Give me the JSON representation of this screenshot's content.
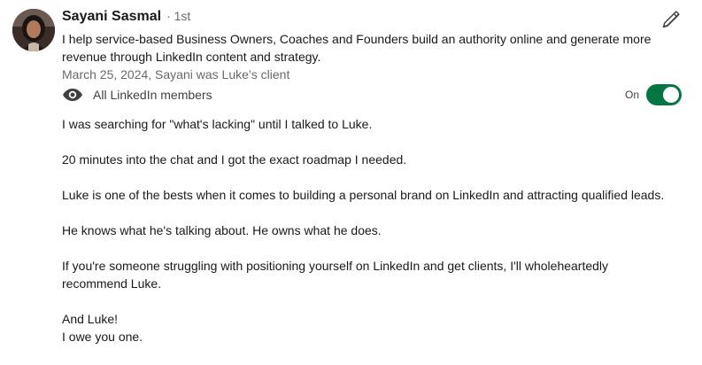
{
  "recommendation": {
    "author_name": "Sayani Sasmal",
    "degree": "· 1st",
    "headline": "I help service-based Business Owners, Coaches and Founders build an authority online and generate more revenue through LinkedIn content and strategy.",
    "meta": "March 25, 2024, Sayani was Luke’s client",
    "visibility": {
      "icon": "eye-icon",
      "label": "All LinkedIn members",
      "toggle_label": "On",
      "toggle_on": true
    },
    "edit_icon": "pencil-icon",
    "paragraphs": [
      "I was searching for \"what's lacking\" until I talked to Luke.",
      "20 minutes into the chat and I got the exact roadmap I needed.",
      "Luke is one of the bests when it comes to building a personal brand on LinkedIn and attracting qualified leads.",
      "He knows what he's talking about. He owns what he does.",
      "If you're someone struggling with positioning yourself on LinkedIn and get clients, I'll wholeheartedly recommend Luke.",
      "And Luke!",
      "I owe you one."
    ]
  },
  "colors": {
    "toggle_on": "#057642",
    "text_primary": "rgba(0,0,0,0.9)",
    "text_secondary": "rgba(0,0,0,0.6)"
  }
}
